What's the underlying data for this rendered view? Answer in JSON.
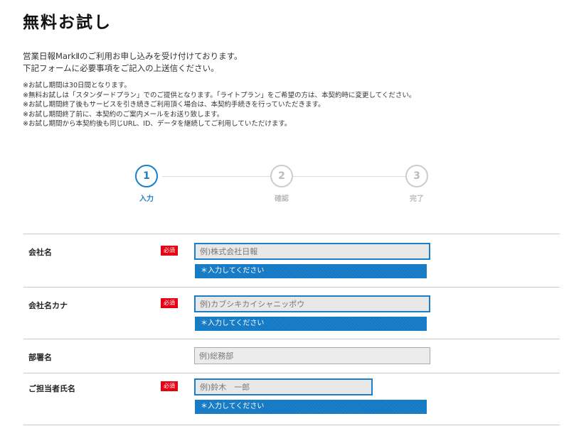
{
  "page_title": "無料お試し",
  "intro": {
    "line1": "営業日報MarkⅡのご利用お申し込みを受け付けております。",
    "line2": "下記フォームに必要事項をご記入の上送信ください。"
  },
  "notes": [
    "※お試し期間は30日間となります。",
    "※無料お試しは「スタンダードプラン」でのご提供となります。「ライトプラン」をご希望の方は、本契約時に変更してください。",
    "※お試し期間終了後もサービスを引き続きご利用頂く場合は、本契約手続きを行っていただきます。",
    "※お試し期間終了前に、本契約のご案内メールをお送り致します。",
    "※お試し期間から本契約後も同じURL、ID、データを継続してご利用していただけます。"
  ],
  "steps": [
    {
      "number": "1",
      "label": "入力",
      "active": true
    },
    {
      "number": "2",
      "label": "確認",
      "active": false
    },
    {
      "number": "3",
      "label": "完了",
      "active": false
    }
  ],
  "form": {
    "required_badge": "必須",
    "error_message": "＊入力してください",
    "company_name": {
      "label": "会社名",
      "placeholder": "例)株式会社日報",
      "value": ""
    },
    "company_kana": {
      "label": "会社名カナ",
      "placeholder": "例)カブシキカイシャニッポウ",
      "value": ""
    },
    "department": {
      "label": "部署名",
      "placeholder": "例)総務部",
      "value": ""
    },
    "contact_name": {
      "label": "ご担当者氏名",
      "placeholder": "例)鈴木　一郎",
      "value": ""
    }
  },
  "colors": {
    "accent": "#1a7ec8",
    "required": "#e60012",
    "error_bg": "#1479c4"
  }
}
